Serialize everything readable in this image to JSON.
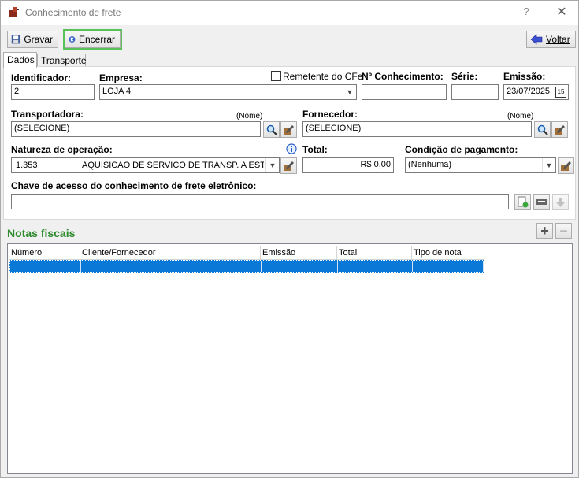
{
  "window": {
    "title": "Conhecimento de frete",
    "help_glyph": "?",
    "close_glyph": "✕"
  },
  "toolbar": {
    "save_label": "Gravar",
    "close_label": "Encerrar",
    "back_label": "Voltar"
  },
  "tabs": [
    {
      "label": "Dados",
      "active": true
    },
    {
      "label": "Transporte",
      "active": false
    }
  ],
  "form": {
    "identificador": {
      "label": "Identificador:",
      "value": "2"
    },
    "empresa": {
      "label": "Empresa:",
      "value": "LOJA 4"
    },
    "remetente_cfe": {
      "label": "Remetente do CFe",
      "checked": false
    },
    "num_conhecimento": {
      "label": "Nº Conhecimento:",
      "value": ""
    },
    "serie": {
      "label": "Série:",
      "value": ""
    },
    "emissao": {
      "label": "Emissão:",
      "value": "23/07/2025",
      "calendar_glyph": "15"
    },
    "transportadora": {
      "label": "Transportadora:",
      "hint": "(Nome)",
      "value": "(SELECIONE)"
    },
    "fornecedor": {
      "label": "Fornecedor:",
      "hint": "(Nome)",
      "value": "(SELECIONE)"
    },
    "natureza": {
      "label": "Natureza de operação:",
      "code": "1.353",
      "description": "AQUISICAO DE SERVICO DE TRANSP. A ESTABE"
    },
    "total": {
      "label": "Total:",
      "value": "R$ 0,00"
    },
    "condicao": {
      "label": "Condição de pagamento:",
      "value": "(Nenhuma)"
    },
    "chave": {
      "label": "Chave de acesso do conhecimento de frete eletrônico:",
      "value": ""
    }
  },
  "notas": {
    "title": "Notas fiscais",
    "add_glyph": "+",
    "remove_glyph": "−",
    "columns": [
      "Número",
      "Cliente/Fornecedor",
      "Emissão",
      "Total",
      "Tipo de nota"
    ],
    "rows": [
      [
        "",
        "",
        "",
        "",
        ""
      ]
    ]
  },
  "colors": {
    "accent_green": "#2d8a2d",
    "selection_blue": "#0a78d7",
    "highlight_outline": "#58c158"
  },
  "icons": {
    "app": "truck-box-icon",
    "save": "floppy-disk-icon",
    "close": "power-exit-icon",
    "back": "back-arrow-icon",
    "search": "magnifier-icon",
    "edit": "pencil-box-icon",
    "info": "info-icon",
    "calendar": "calendar-icon"
  }
}
